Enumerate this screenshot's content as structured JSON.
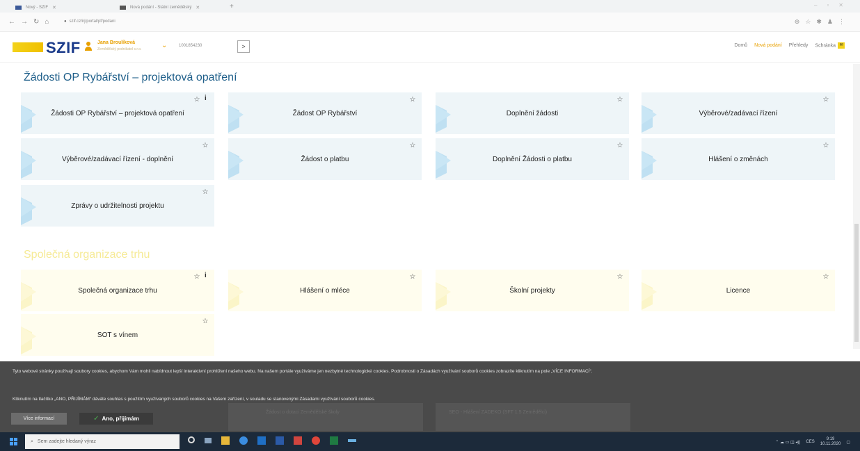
{
  "browser": {
    "tabs": [
      {
        "label": "Nový - SZIF"
      },
      {
        "label": "Nová podání - Státní zemědělský"
      }
    ],
    "url": "szif.cz/irj/portal/pf/podani"
  },
  "header": {
    "logo": "SZIF",
    "user_name": "Jana Broulíková",
    "user_sub": "Zemědělský podnikatel s.r.o.",
    "user_id": "1001854230",
    "nav": {
      "home": "Domů",
      "new": "Nová podání",
      "overview": "Přehledy",
      "inbox": "Schránka"
    }
  },
  "sections": {
    "fisheries": {
      "title": "Žádosti OP Rybářství – projektová opatření",
      "tiles": [
        "Žádosti OP Rybářství – projektová opatření",
        "Žádost OP Rybářství",
        "Doplnění žádosti",
        "Výběrové/zadávací řízení",
        "Výběrové/zadávací řízení - doplnění",
        "Žádost o platbu",
        "Doplnění Žádosti o platbu",
        "Hlášení o změnách",
        "Zprávy o udržitelnosti projektu"
      ]
    },
    "market": {
      "title": "Společná organizace trhu",
      "tiles": [
        "Společná organizace trhu",
        "Hlášení o mléce",
        "Školní projekty",
        "Licence",
        "SOT s vínem"
      ]
    }
  },
  "cookie": {
    "text1": "Tyto webové stránky používají soubory cookies, abychom Vám mohli nabídnout lepší interaktivní prohlížení našeho webu. Na našem portále využíváme jen nezbytné technologické cookies. Podrobnosti o Zásadách využívání souborů cookies zobrazíte kliknutím na pole „VÍCE INFORMACÍ“.",
    "text2": "Kliknutím na tlačítko „ANO, PŘIJÍMÁM“ dáváte souhlas s použitím využívaných souborů cookies na Vašem zařízení, v souladu se stanovenými Zásadami využívání souborů cookies.",
    "more": "Více informací",
    "accept": "Ano, přijímám",
    "ghost1": "Žádost o dotaci Zemědělské školy",
    "ghost2": "SEO - Hlášení ZADEKO (SFT 1.5 Zemědělci)"
  },
  "taskbar": {
    "search_placeholder": "Sem zadejte hledaný výraz",
    "lang": "CES",
    "time": "9:19",
    "date": "10.11.2020"
  },
  "colors": {
    "brand_blue": "#1a3a8a",
    "accent_yellow": "#f3d21a",
    "section_blue": "#1f5f8a",
    "tile_blue": "#eef5f8",
    "tile_yellow": "#fffdee"
  }
}
